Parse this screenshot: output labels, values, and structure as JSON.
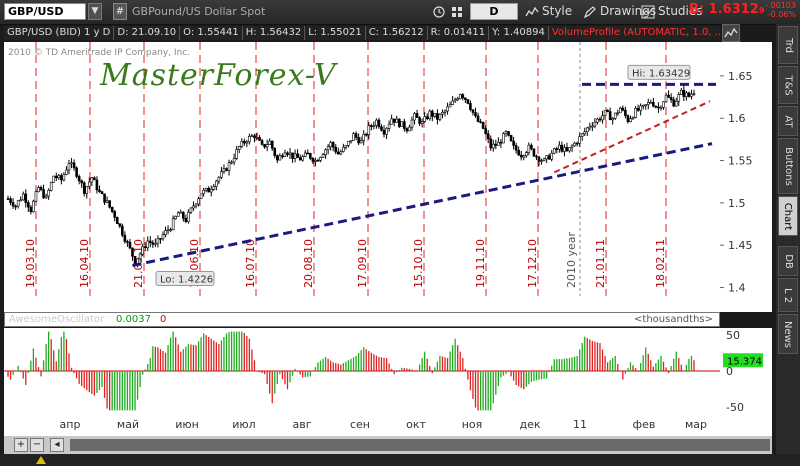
{
  "toolbar": {
    "symbol": "GBP/USD",
    "hash_label": "#",
    "description": "GBPound/US Dollar Spot",
    "period_label": "D",
    "style_label": "Style",
    "drawings_label": "Drawings",
    "studies_label": "Studies",
    "bid_label": "B: 1.6312",
    "bid_suffix": "9",
    "change_abs": "-.00103",
    "change_pct": "-0.06%"
  },
  "info_bar": {
    "title": "GBP/USD (BID) 1 y D",
    "date": "D: 21.09.10",
    "open": "O: 1.55441",
    "high": "H: 1.56432",
    "low": "L: 1.55021",
    "close": "C: 1.56212",
    "range": "R: 0.01411",
    "year": "Y: 1.40894",
    "volume_profile": "VolumeProfile (AUTOMATIC, 1.0, ..."
  },
  "copyright": "2010 © TD Ameritrade IP Company, Inc.",
  "watermark": "MasterForex-V",
  "sidebar_tabs": [
    "Trd",
    "T&S",
    "AT",
    "Buttons",
    "Chart",
    "DB",
    "L 2",
    "News"
  ],
  "active_tab": "Chart",
  "chart_data": [
    {
      "type": "candlestick",
      "title": "GBP/USD (BID) 1 y D",
      "y_ticks": [
        "1.65",
        "1.6",
        "1.55",
        "1.5",
        "1.45",
        "1.4"
      ],
      "ylim": [
        1.39,
        1.69
      ],
      "date_labels": [
        "19.03.10",
        "16.04.10",
        "21.05.10",
        "18.06.10",
        "16.07.10",
        "20.08.10",
        "17.09.10",
        "15.10.10",
        "19.11.10",
        "17.12.10",
        "21.01.11",
        "18.02.11"
      ],
      "year_label": "2010 year",
      "annotations": {
        "high": "Hi: 1.63429",
        "low": "Lo: 1.4226"
      },
      "close_path": [
        [
          0,
          1.505
        ],
        [
          6,
          1.497
        ],
        [
          12,
          1.51
        ],
        [
          18,
          1.492
        ],
        [
          24,
          1.518
        ],
        [
          30,
          1.505
        ],
        [
          36,
          1.532
        ],
        [
          42,
          1.527
        ],
        [
          48,
          1.548
        ],
        [
          54,
          1.535
        ],
        [
          60,
          1.515
        ],
        [
          66,
          1.53
        ],
        [
          72,
          1.512
        ],
        [
          78,
          1.5
        ],
        [
          84,
          1.485
        ],
        [
          90,
          1.465
        ],
        [
          96,
          1.445
        ],
        [
          100,
          1.431
        ],
        [
          104,
          1.44
        ],
        [
          110,
          1.455
        ],
        [
          116,
          1.45
        ],
        [
          122,
          1.462
        ],
        [
          128,
          1.472
        ],
        [
          134,
          1.488
        ],
        [
          140,
          1.48
        ],
        [
          146,
          1.497
        ],
        [
          152,
          1.512
        ],
        [
          158,
          1.515
        ],
        [
          164,
          1.527
        ],
        [
          170,
          1.537
        ],
        [
          176,
          1.55
        ],
        [
          182,
          1.566
        ],
        [
          188,
          1.575
        ],
        [
          194,
          1.58
        ],
        [
          200,
          1.566
        ],
        [
          206,
          1.572
        ],
        [
          212,
          1.55
        ],
        [
          218,
          1.563
        ],
        [
          224,
          1.555
        ],
        [
          230,
          1.552
        ],
        [
          236,
          1.557
        ],
        [
          242,
          1.55
        ],
        [
          248,
          1.56
        ],
        [
          254,
          1.57
        ],
        [
          260,
          1.558
        ],
        [
          266,
          1.566
        ],
        [
          272,
          1.58
        ],
        [
          278,
          1.572
        ],
        [
          284,
          1.588
        ],
        [
          290,
          1.597
        ],
        [
          296,
          1.585
        ],
        [
          302,
          1.6
        ],
        [
          308,
          1.594
        ],
        [
          314,
          1.588
        ],
        [
          320,
          1.602
        ],
        [
          326,
          1.594
        ],
        [
          332,
          1.606
        ],
        [
          338,
          1.6
        ],
        [
          344,
          1.608
        ],
        [
          350,
          1.618
        ],
        [
          356,
          1.63
        ],
        [
          362,
          1.62
        ],
        [
          368,
          1.6
        ],
        [
          374,
          1.588
        ],
        [
          380,
          1.566
        ],
        [
          386,
          1.57
        ],
        [
          392,
          1.582
        ],
        [
          398,
          1.565
        ],
        [
          404,
          1.557
        ],
        [
          410,
          1.565
        ],
        [
          416,
          1.555
        ],
        [
          422,
          1.549
        ],
        [
          428,
          1.558
        ],
        [
          434,
          1.566
        ],
        [
          440,
          1.56
        ],
        [
          446,
          1.57
        ],
        [
          452,
          1.58
        ],
        [
          458,
          1.592
        ],
        [
          464,
          1.598
        ],
        [
          470,
          1.606
        ],
        [
          476,
          1.6
        ],
        [
          482,
          1.612
        ],
        [
          488,
          1.598
        ],
        [
          494,
          1.608
        ],
        [
          500,
          1.612
        ],
        [
          506,
          1.62
        ],
        [
          512,
          1.612
        ],
        [
          518,
          1.626
        ],
        [
          524,
          1.618
        ],
        [
          530,
          1.63
        ],
        [
          536,
          1.626
        ],
        [
          540,
          1.632
        ]
      ]
    },
    {
      "type": "bar",
      "title": "AwesomeOscillator",
      "value_label": "0.0037",
      "count_label": "0",
      "unit_label": "<thousandths>",
      "current_value_label": "15.374",
      "y_ticks": [
        "50",
        "0",
        "-50"
      ],
      "ylim": [
        -60,
        60
      ],
      "month_labels": [
        "апр",
        "май",
        "июн",
        "июл",
        "авг",
        "сен",
        "окт",
        "ноя",
        "дек",
        "11",
        "фев",
        "мар"
      ]
    }
  ]
}
